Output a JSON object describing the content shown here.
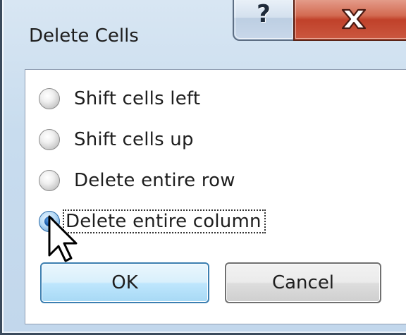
{
  "dialog": {
    "title": "Delete Cells",
    "help_icon": "question-mark-icon",
    "close_icon": "close-x-icon"
  },
  "options": [
    {
      "label": "Shift cells left",
      "selected": false
    },
    {
      "label": "Shift cells up",
      "selected": false
    },
    {
      "label": "Delete entire row",
      "selected": false
    },
    {
      "label": "Delete entire column",
      "selected": true
    }
  ],
  "buttons": {
    "ok_label": "OK",
    "cancel_label": "Cancel"
  },
  "colors": {
    "titlebar": "#c8dcee",
    "close_button": "#c0412a",
    "ok_border": "#3c7fb1",
    "radio_selected": "#1c5fae"
  },
  "cursor_icon": "mouse-pointer-arrow-icon"
}
